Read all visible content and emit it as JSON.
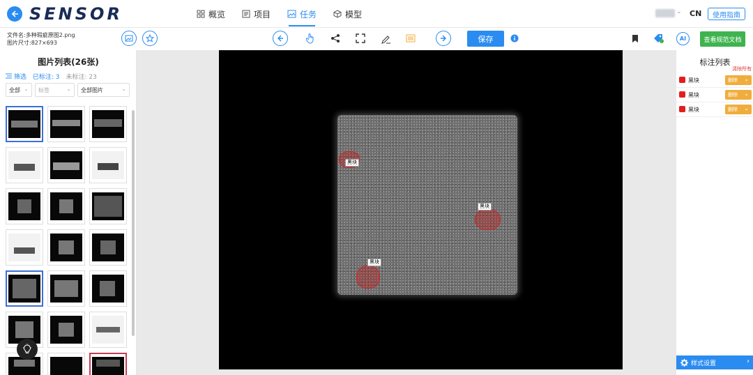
{
  "app": {
    "logo": "SENSOR"
  },
  "nav": [
    {
      "label": "概览",
      "icon": "grid-icon"
    },
    {
      "label": "项目",
      "icon": "list-icon"
    },
    {
      "label": "任务",
      "icon": "image-task-icon",
      "active": true
    },
    {
      "label": "模型",
      "icon": "cube-icon"
    }
  ],
  "header": {
    "lang": "CN",
    "guide": "使用指南"
  },
  "file": {
    "name": "文件名:多种瑕疵原图2.png",
    "size": "图片尺寸:827×693"
  },
  "toolbar": {
    "save": "保存",
    "doc": "查看规范文档",
    "ai": "AI"
  },
  "left": {
    "title": "图片列表(26张)",
    "filter": "筛选",
    "labeled": "已标注: 3",
    "unlabeled": "未标注: 23",
    "sel1": "全部",
    "sel2": "标签",
    "sel3": "全部图片"
  },
  "annotations": {
    "title": "标注列表",
    "clear": "清除所有",
    "items": [
      {
        "name": "黑块",
        "action": "删除"
      },
      {
        "name": "黑块",
        "action": "删除"
      },
      {
        "name": "黑块",
        "action": "删除"
      }
    ],
    "style": "样式设置"
  },
  "canvas": {
    "labels": [
      "黑块",
      "黑块",
      "黑块"
    ]
  },
  "colors": {
    "accent": "#2a8cf0",
    "defect": "#d32222",
    "doc": "#3fb34f",
    "delete": "#f0ad3c"
  }
}
